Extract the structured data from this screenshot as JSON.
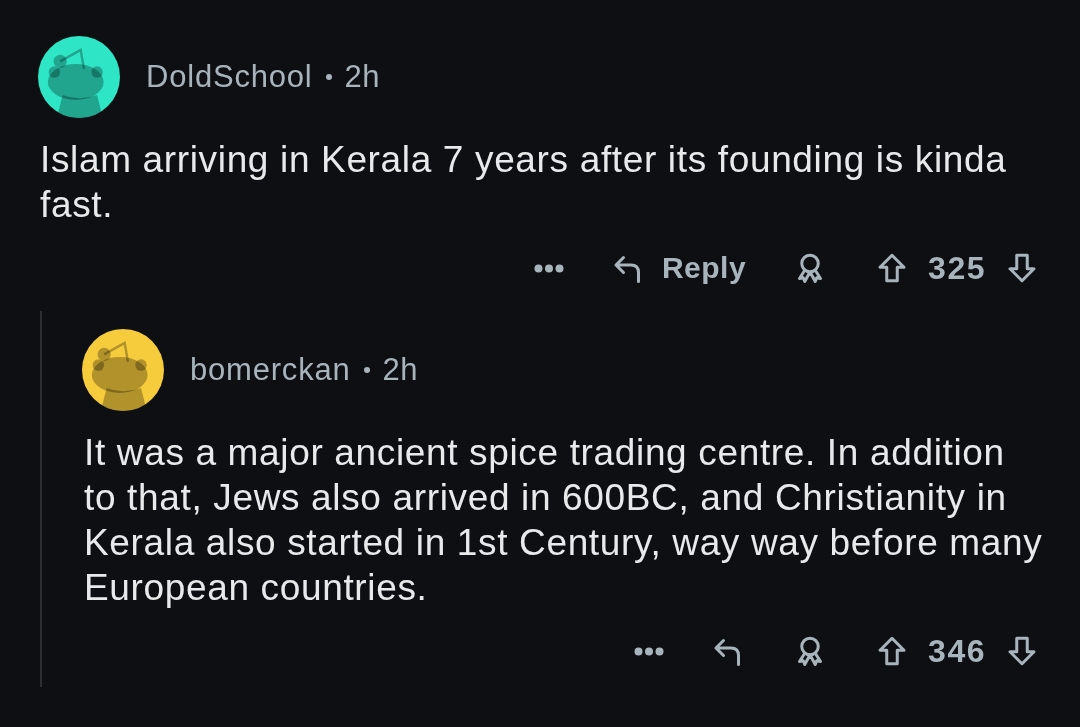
{
  "comments": [
    {
      "author": "DoldSchool",
      "time": "2h",
      "color": "#2ee5c6",
      "body": "Islam arriving in Kerala 7 years after its founding is kinda fast.",
      "actions": {
        "reply_label": "Reply",
        "score": "325"
      },
      "children": [
        {
          "author": "bomerckan",
          "time": "2h",
          "color": "#f6cb3c",
          "body": "It was a major ancient spice trading centre. In addition to that, Jews also arrived in 600BC, and Christianity in Kerala also started in 1st Century, way way before many European countries.",
          "actions": {
            "score": "346"
          }
        }
      ]
    }
  ]
}
